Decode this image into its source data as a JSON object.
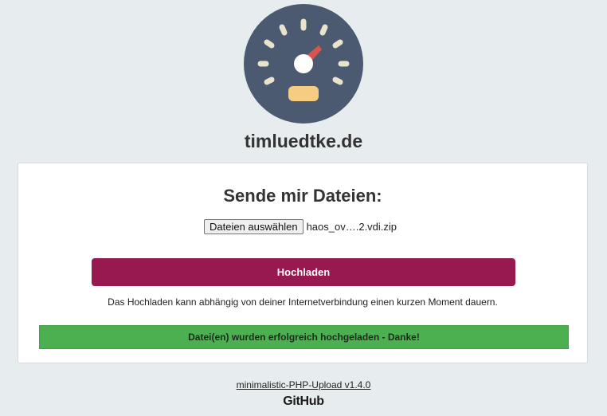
{
  "header": {
    "logo_icon": "speedometer-icon",
    "site_title": "timluedtke.de"
  },
  "upload_card": {
    "heading": "Sende mir Dateien:",
    "file_button_label": "Dateien auswählen",
    "selected_file_name": "haos_ov….2.vdi.zip",
    "upload_button_label": "Hochladen",
    "hint_text": "Das Hochladen kann abhängig von deiner Internetverbindung einen kurzen Moment dauern.",
    "success_message": "Datei(en) wurden erfolgreich hochgeladen - Danke!"
  },
  "footer": {
    "version_link": "minimalistic-PHP-Upload v1.4.0",
    "github_label": "GitHub"
  },
  "colors": {
    "background": "#e7ecee",
    "logo_circle": "#4b5a70",
    "needle": "#d9534f",
    "upload_button": "#98194f",
    "success_background": "#4caf50"
  }
}
